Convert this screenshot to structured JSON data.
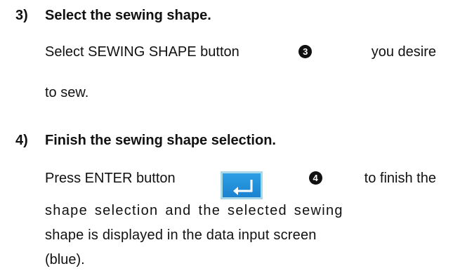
{
  "steps": [
    {
      "number": "3)",
      "title": "Select the sewing shape.",
      "line1_before": "Select SEWING SHAPE button",
      "line1_badge": "3",
      "line1_after": "you desire",
      "line2": "to sew."
    },
    {
      "number": "4)",
      "title": "Finish the sewing shape selection.",
      "line1_before": "Press ENTER button",
      "line1_button_icon": "enter-icon",
      "line1_badge": "4",
      "line1_after": "to finish the",
      "line2": "shape selection and the selected sewing",
      "line3": "shape is displayed in the data input screen",
      "line4": "(blue)."
    }
  ],
  "colors": {
    "text": "#111111",
    "enter_button": "#1b82cf",
    "enter_button_border": "#a8d8e8"
  }
}
